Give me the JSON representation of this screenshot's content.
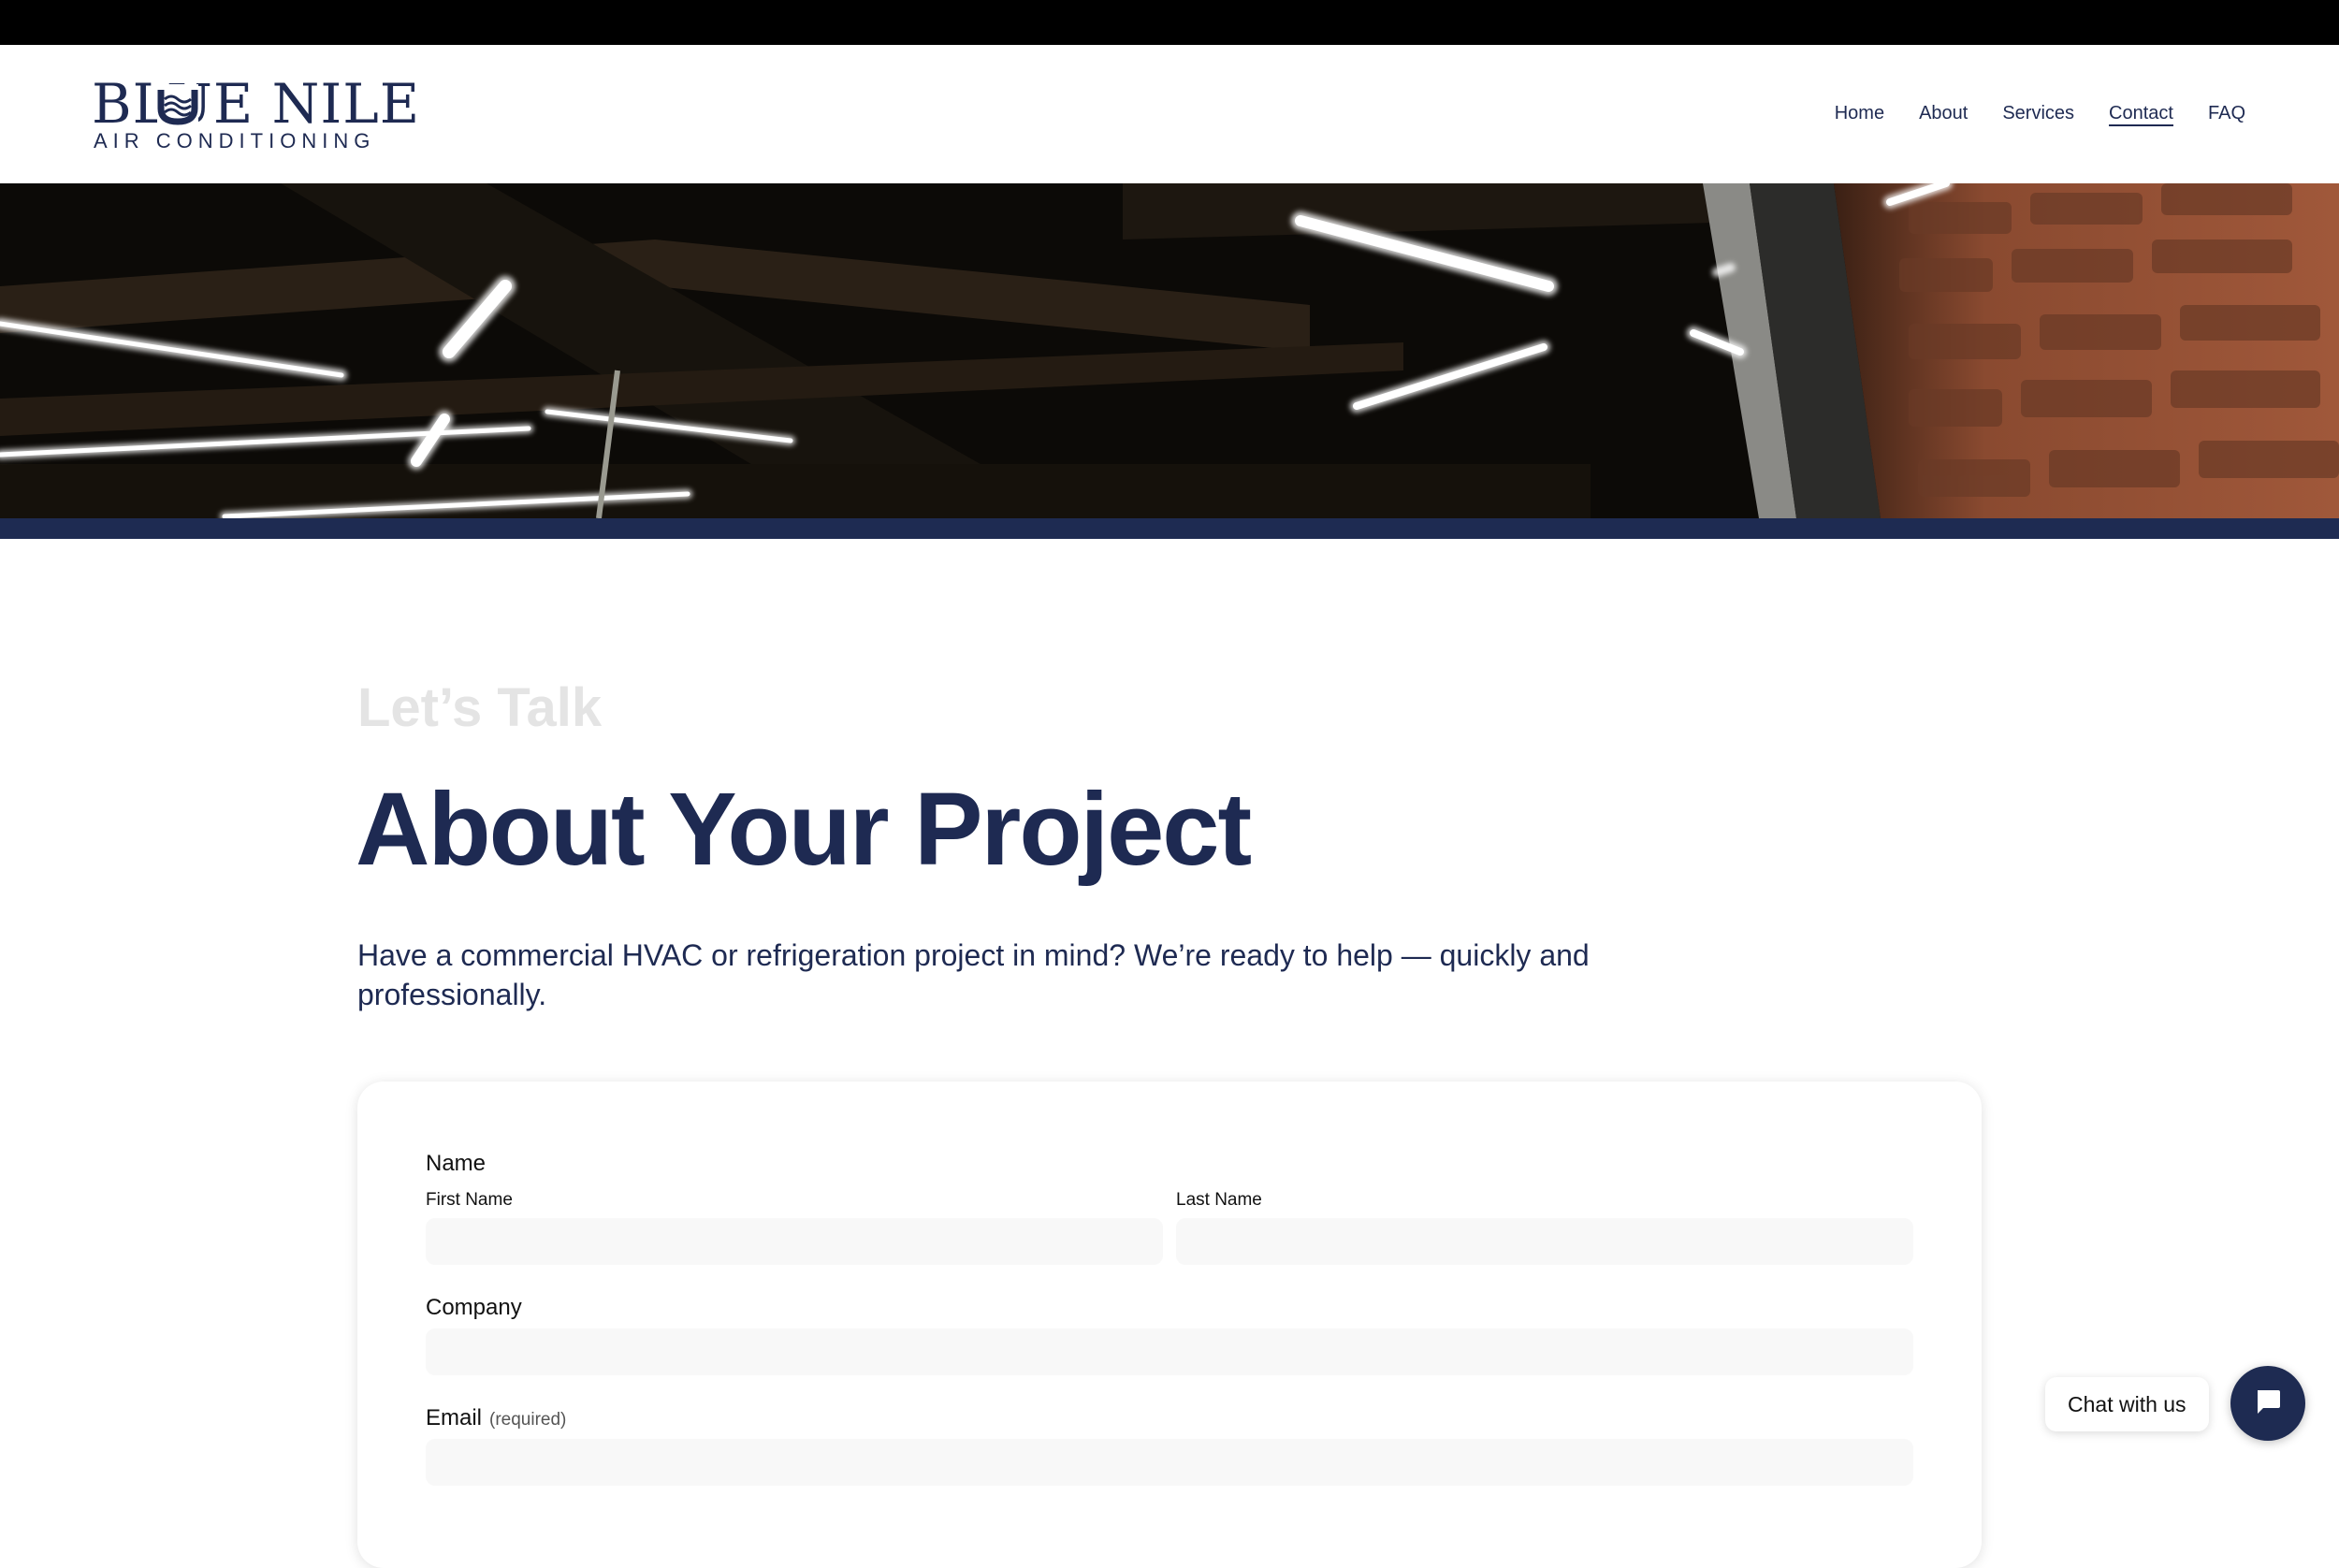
{
  "brand": {
    "logo_main": "BLUE NILE",
    "logo_sub": "AIR CONDITIONING",
    "color_primary": "#1e2a52"
  },
  "nav": {
    "items": [
      {
        "label": "Home"
      },
      {
        "label": "About"
      },
      {
        "label": "Services"
      },
      {
        "label": "Contact",
        "active": true
      },
      {
        "label": "FAQ"
      }
    ]
  },
  "hero": {
    "description": "Photo of a dark warehouse ceiling with long fluorescent tube lights and a red brick wall"
  },
  "intro": {
    "eyebrow": "Let’s Talk",
    "title": "About Your Project",
    "lead": "Have a commercial HVAC or refrigeration project in mind? We’re ready to help — quickly and professionally."
  },
  "form": {
    "name_label": "Name",
    "first_name_label": "First Name",
    "first_name_value": "",
    "last_name_label": "Last Name",
    "last_name_value": "",
    "company_label": "Company",
    "company_value": "",
    "email_label": "Email",
    "email_required": "(required)",
    "email_value": ""
  },
  "chat": {
    "label": "Chat with us",
    "icon": "chat-bubble-icon"
  }
}
